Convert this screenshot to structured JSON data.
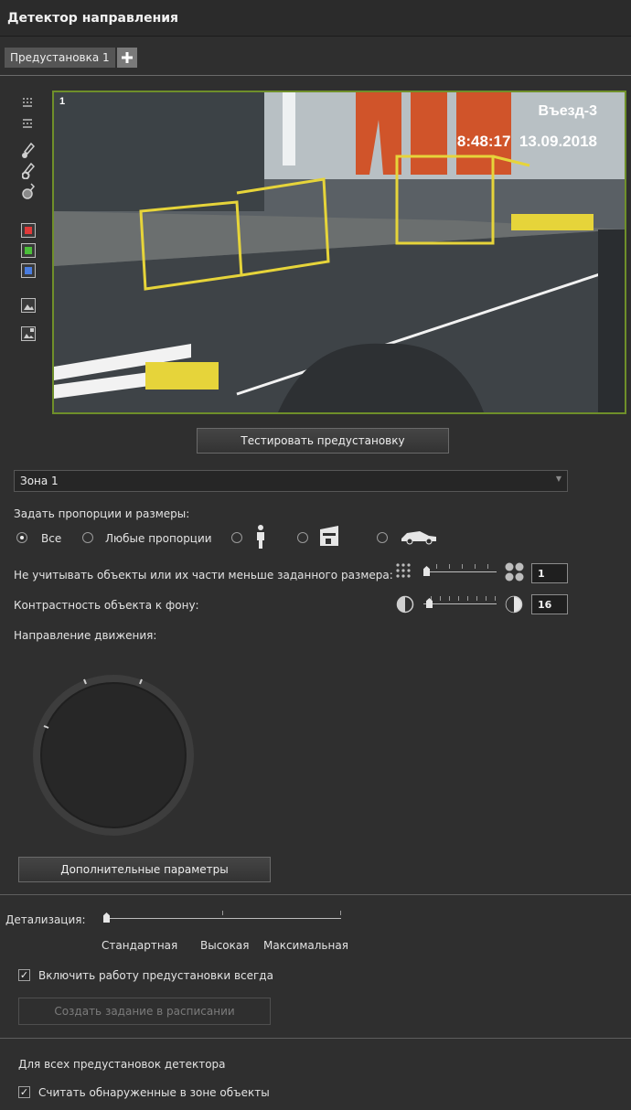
{
  "header": {
    "title": "Детектор направления"
  },
  "tabs": {
    "preset_label": "Предустановка 1",
    "add_icon": "plus-icon"
  },
  "toolbar": {
    "icons": [
      "grid-dots-icon",
      "grid-lines-icon",
      "brush-icon",
      "brush-erase-icon",
      "brush-fill-icon",
      "red-square-icon",
      "green-square-icon",
      "blue-square-icon",
      "image-tool-icon",
      "image-add-icon"
    ],
    "colors": {
      "red": "#e03a3a",
      "green": "#4bbf3a",
      "blue": "#4a7de0"
    }
  },
  "video": {
    "cam_number": "1",
    "cam_name": "Въезд-3",
    "timestamp": "8:48:17  13.09.2018",
    "border_color": "#6f8f2a"
  },
  "test_button": "Тестировать предустановку",
  "zone": {
    "selected": "Зона 1"
  },
  "proportions": {
    "label": "Задать пропорции и размеры:",
    "options": [
      "Все",
      "Любые пропорции",
      "",
      "",
      ""
    ],
    "selected_index": 0,
    "icons": [
      "person-icon",
      "truck-icon",
      "car-icon"
    ]
  },
  "min_size": {
    "label": "Не учитывать объекты или их части меньше заданного размера:",
    "value": "1",
    "fraction": 0.0
  },
  "contrast": {
    "label": "Контрастность объекта к фону:",
    "value": "16",
    "fraction": 0.04
  },
  "direction": {
    "label": "Направление движения:"
  },
  "advanced_button": "Дополнительные параметры",
  "detail": {
    "label": "Детализация:",
    "levels": [
      "Стандартная",
      "Высокая",
      "Максимальная"
    ],
    "selected_index": 0
  },
  "always_on": {
    "label": "Включить работу предустановки всегда",
    "checked": true
  },
  "schedule_button": "Создать задание в расписании",
  "all_presets": {
    "label": "Для всех предустановок детектора",
    "count_objects": {
      "label": "Считать обнаруженные в зоне объекты",
      "checked": true
    }
  }
}
